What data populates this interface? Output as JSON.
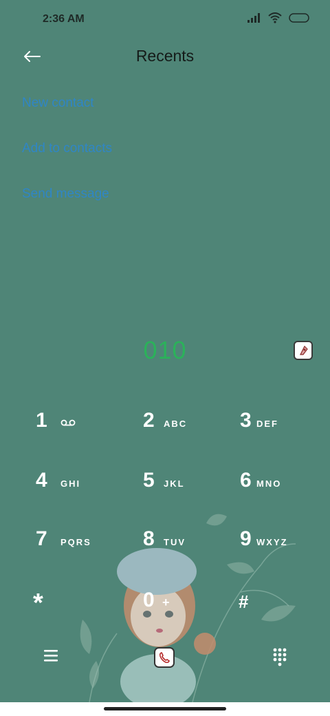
{
  "status": {
    "time": "2:36 AM"
  },
  "header": {
    "title": "Recents"
  },
  "menu": {
    "new_contact": "New contact",
    "add_to_contacts": "Add to contacts",
    "send_message": "Send message"
  },
  "dial": {
    "number": "010"
  },
  "keypad": {
    "k1": {
      "digit": "1",
      "letters": ""
    },
    "k2": {
      "digit": "2",
      "letters": "ABC"
    },
    "k3": {
      "digit": "3",
      "letters": "DEF"
    },
    "k4": {
      "digit": "4",
      "letters": "GHI"
    },
    "k5": {
      "digit": "5",
      "letters": "JKL"
    },
    "k6": {
      "digit": "6",
      "letters": "MNO"
    },
    "k7": {
      "digit": "7",
      "letters": "PQRS"
    },
    "k8": {
      "digit": "8",
      "letters": "TUV"
    },
    "k9": {
      "digit": "9",
      "letters": "WXYZ"
    },
    "kstar": {
      "digit": "*",
      "letters": ""
    },
    "k0": {
      "digit": "0",
      "letters": "+"
    },
    "khash": {
      "digit": "#",
      "letters": ""
    }
  },
  "icons": {
    "back": "arrow-left-icon",
    "sim": "sim-card-icon",
    "menu": "hamburger-icon",
    "call": "phone-icon",
    "dialpad": "dialpad-icon",
    "voicemail": "voicemail-icon"
  },
  "colors": {
    "background": "#4f8577",
    "link": "#2f86c6",
    "number": "#2bb25a"
  }
}
